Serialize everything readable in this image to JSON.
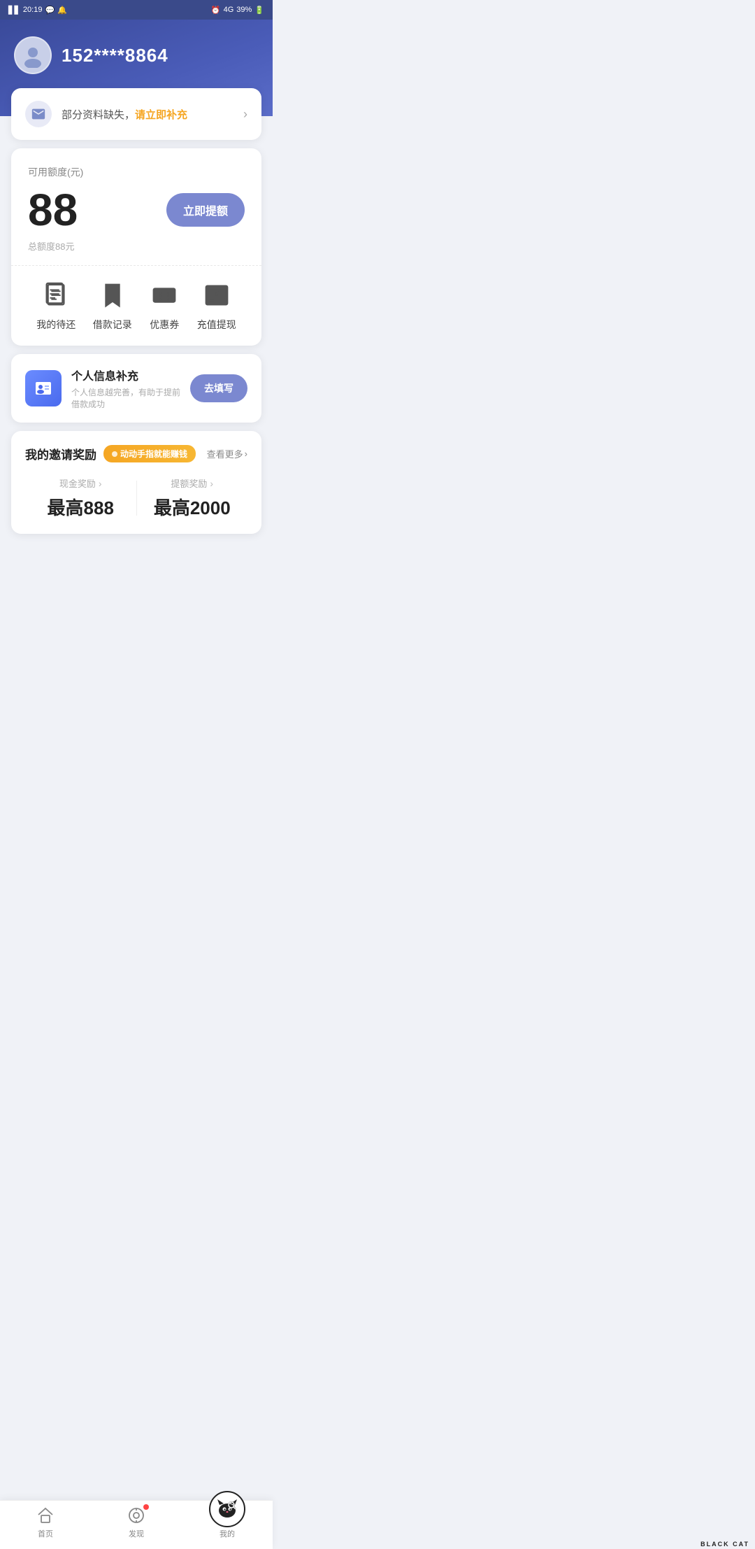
{
  "statusBar": {
    "time": "20:19",
    "signal": "4G",
    "battery": "39%"
  },
  "profile": {
    "phone": "152****8864",
    "avatarAlt": "user-avatar"
  },
  "infoMissing": {
    "text": "部分资料缺失，",
    "linkText": "请立即补充",
    "chevron": "›"
  },
  "credit": {
    "label": "可用额度(元)",
    "amount": "88",
    "totalLabel": "总额度88元",
    "withdrawLabel": "立即提额"
  },
  "quickMenu": {
    "items": [
      {
        "id": "pending",
        "label": "我的待还",
        "icon": "document"
      },
      {
        "id": "records",
        "label": "借款记录",
        "icon": "bookmark"
      },
      {
        "id": "coupons",
        "label": "优惠券",
        "icon": "ticket"
      },
      {
        "id": "recharge",
        "label": "充值提现",
        "icon": "atm"
      }
    ]
  },
  "personalInfo": {
    "icon": "person-card",
    "title": "个人信息补充",
    "subtitle": "个人信息越完善，有助于提前借款成功",
    "buttonLabel": "去填写"
  },
  "inviteReward": {
    "title": "我的邀请奖励",
    "badge": "动动手指就能赚钱",
    "viewMore": "查看更多",
    "chevron": "›",
    "cashReward": {
      "label": "现金奖励",
      "value": "最高888",
      "chevron": "›"
    },
    "creditReward": {
      "label": "提额奖励",
      "value": "最高2000",
      "chevron": "›"
    }
  },
  "bottomNav": {
    "items": [
      {
        "id": "home",
        "label": "首页",
        "icon": "home",
        "active": false
      },
      {
        "id": "discover",
        "label": "发现",
        "icon": "clock",
        "active": false,
        "hasNotification": true
      },
      {
        "id": "mine",
        "label": "我的",
        "icon": "person",
        "active": true
      }
    ]
  },
  "watermark": {
    "text": "BLACK CAT"
  }
}
